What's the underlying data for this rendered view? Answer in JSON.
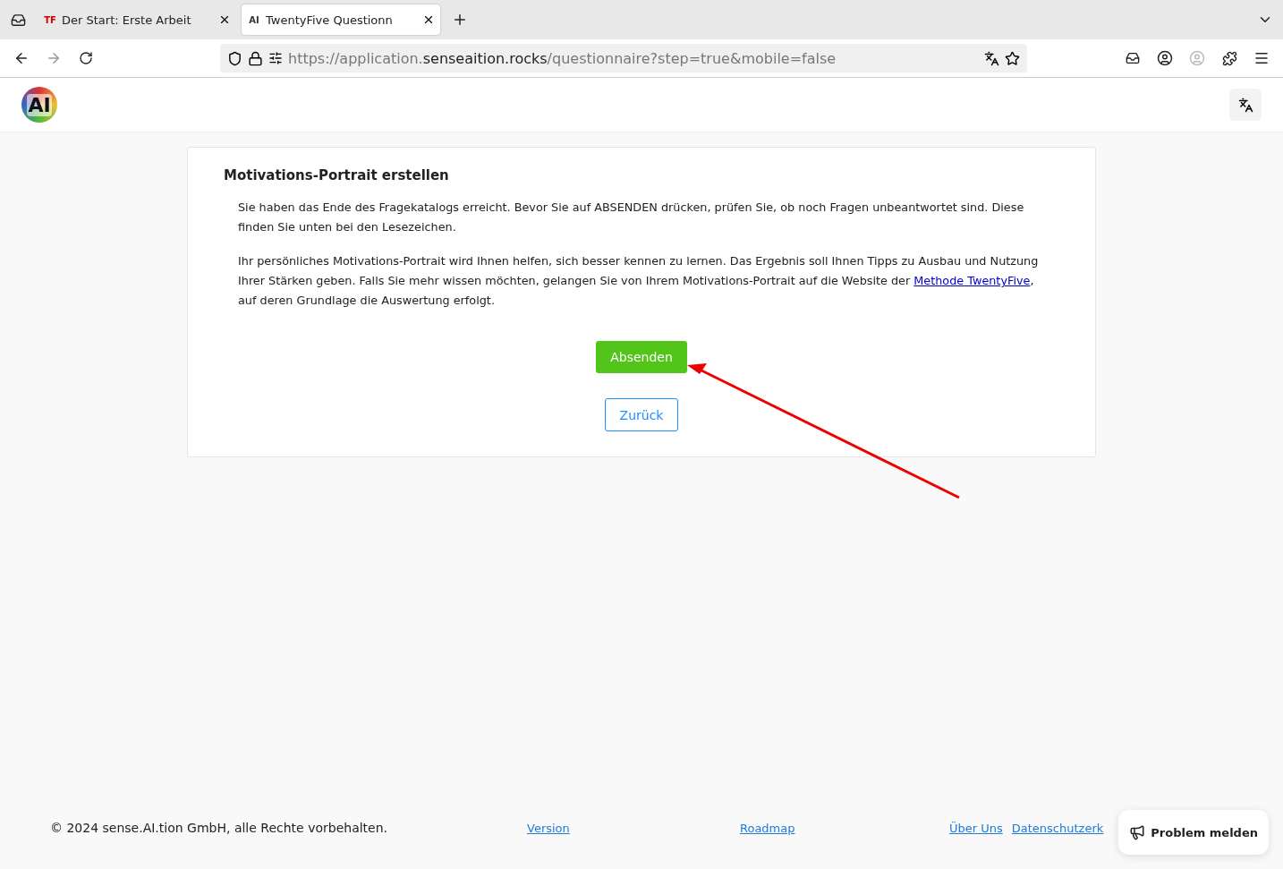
{
  "browser": {
    "tabs": [
      {
        "title": "Der Start: Erste Arbeit",
        "favicon": "TF",
        "selected": false
      },
      {
        "title": "TwentyFive Questionn",
        "favicon": "AI",
        "selected": true
      }
    ],
    "url": {
      "prefix": "https://application.",
      "domain": "senseaition.rocks",
      "path": "/questionnaire?step=true&mobile=false"
    }
  },
  "header": {
    "logo": "AI"
  },
  "card": {
    "title": "Motivations-Portrait erstellen",
    "paragraphs": [
      {
        "text": "Sie haben das Ende des Fragekatalogs erreicht. Bevor Sie auf ABSENDEN drücken, prüfen Sie, ob noch Fragen unbeantwortet sind. Diese finden Sie unten bei den Lesezeichen."
      },
      {
        "text": "Ihr persönliches Motivations-Portrait wird Ihnen helfen, sich besser kennen zu lernen. Das Ergebnis soll Ihnen Tipps zu Ausbau und Nutzung Ihrer Stärken geben. Falls Sie mehr wissen möchten, gelangen Sie von Ihrem Motivations-Portrait auf die Website der ",
        "link": "Methode TwentyFive",
        "after": ", auf deren Grundlage die Auswertung erfolgt."
      }
    ],
    "primary_button": "Absenden",
    "secondary_button": "Zurück"
  },
  "footer": {
    "copyright": "© 2024 sense.AI.tion GmbH, alle Rechte vorbehalten.",
    "links": [
      "Version",
      "Roadmap",
      "Über Uns",
      "Datenschutzerk"
    ]
  },
  "feedback_button": "Problem melden"
}
